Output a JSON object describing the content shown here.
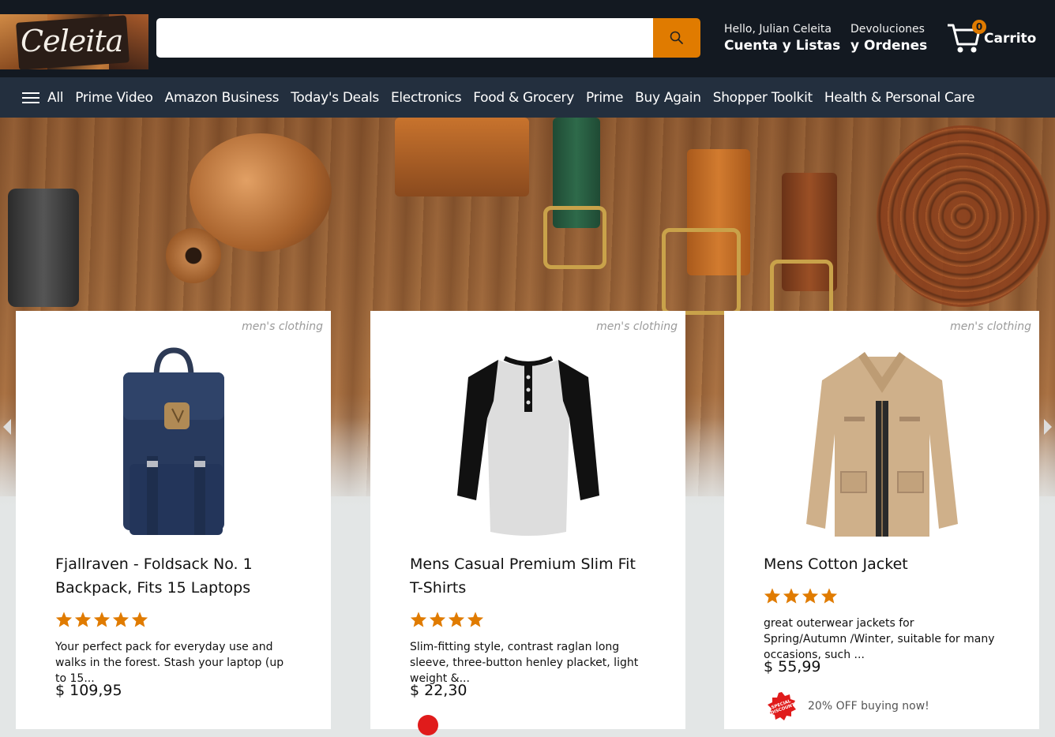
{
  "header": {
    "logo_text": "Celeita",
    "search": {
      "placeholder": "",
      "value": ""
    },
    "account": {
      "greeting": "Hello, Julian Celeita",
      "label": "Cuenta y Listas"
    },
    "returns": {
      "line1": "Devoluciones",
      "line2": "y Ordenes"
    },
    "cart": {
      "count": "0",
      "label": "Carrito"
    },
    "colors": {
      "bg": "#131921",
      "accent": "#e07b00"
    }
  },
  "nav": {
    "all_label": "All",
    "items": [
      "Prime Video",
      "Amazon Business",
      "Today's Deals",
      "Electronics",
      "Food & Grocery",
      "Prime",
      "Buy Again",
      "Shopper Toolkit",
      "Health & Personal Care"
    ]
  },
  "products": [
    {
      "category": "men's clothing",
      "title": "Fjallraven - Foldsack No. 1 Backpack, Fits 15 Laptops",
      "rating": 5,
      "description": "Your perfect pack for everyday use and walks in the forest. Stash your laptop (up to 15...",
      "price": "$ 109,95",
      "image": "backpack"
    },
    {
      "category": "men's clothing",
      "title": "Mens Casual Premium Slim Fit T-Shirts",
      "rating": 4,
      "description": "Slim-fitting style, contrast raglan long sleeve, three-button henley placket, light weight &...",
      "price": "$ 22,30",
      "image": "raglan-shirt"
    },
    {
      "category": "men's clothing",
      "title": "Mens Cotton Jacket",
      "rating": 4,
      "description": "great outerwear jackets for Spring/Autumn /Winter, suitable for many occasions, such ...",
      "price": "$ 55,99",
      "image": "cotton-jacket",
      "promo": {
        "badge_text": "SPECIAL DISCOUNT",
        "text": "20% OFF buying now!"
      }
    }
  ]
}
